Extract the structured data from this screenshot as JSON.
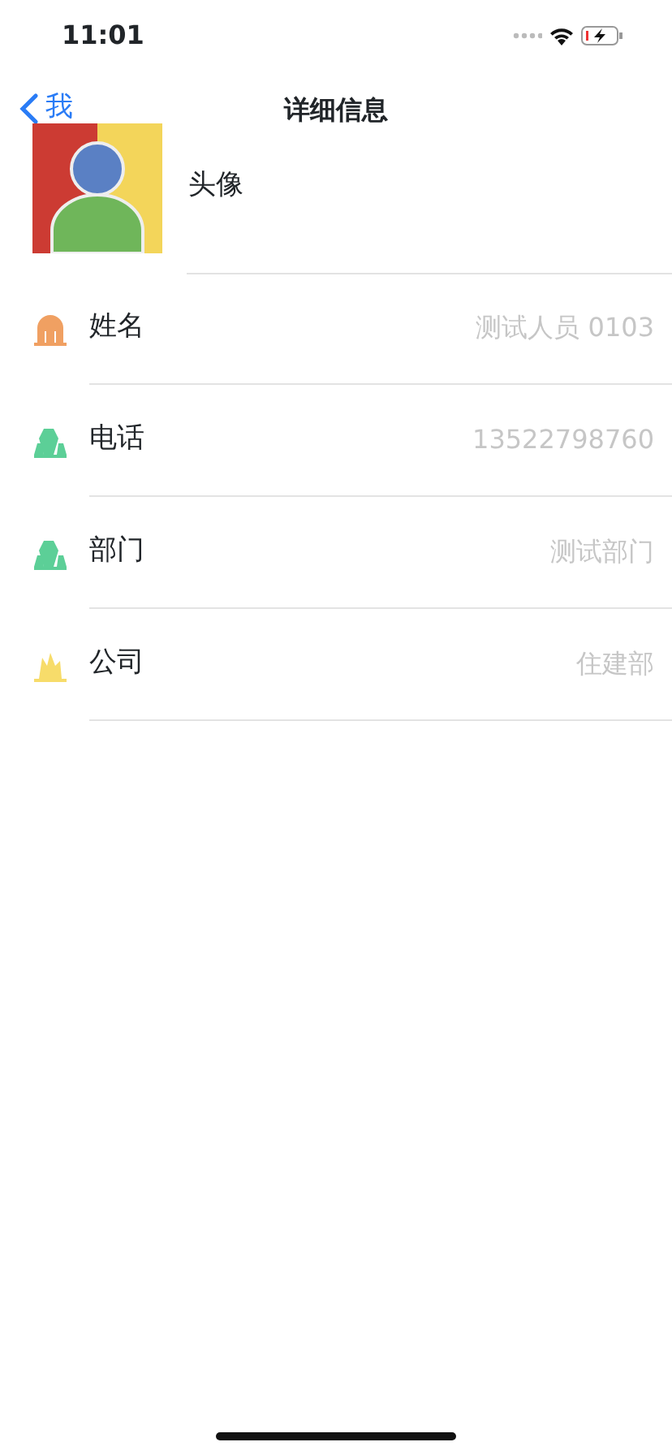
{
  "status_bar": {
    "time": "11:01"
  },
  "nav": {
    "back": "我",
    "title": "详细信息"
  },
  "avatar_row": {
    "label": "头像"
  },
  "fields": [
    {
      "label": "姓名",
      "value": "测试人员 0103",
      "color": "#f0a062",
      "kind": "arch"
    },
    {
      "label": "电话",
      "value": "13522798760",
      "color": "#5ccf97",
      "kind": "trees"
    },
    {
      "label": "部门",
      "value": "测试部门",
      "color": "#5ccf97",
      "kind": "trees"
    },
    {
      "label": "公司",
      "value": "住建部",
      "color": "#f7dc6a",
      "kind": "flame"
    }
  ]
}
